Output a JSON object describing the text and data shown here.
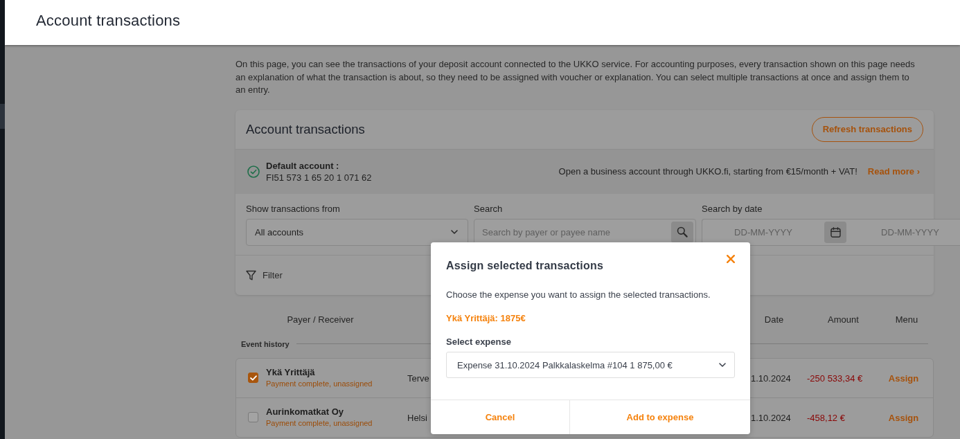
{
  "header": {
    "title": "Account transactions"
  },
  "intro": "On this page, you can see the transactions of your deposit account connected to the UKKO service. For accounting purposes, every transaction shown on this page needs an explanation of what the transaction is about, so they need to be assigned with voucher or explanation. You can select multiple transactions at once and assign them to an entry.",
  "card": {
    "title": "Account transactions",
    "refresh_button": "Refresh transactions",
    "account": {
      "label": "Default account :",
      "number": "FI51 573 1 65 20 1 071 62",
      "promo": "Open a business account through UKKO.fi, starting from €15/month + VAT!",
      "link": "Read more ›"
    },
    "filters": [
      {
        "kind": "select",
        "label": "Show transactions from",
        "value": "All accounts"
      },
      {
        "kind": "search",
        "label": "Search",
        "placeholder": "Search by payer or payee name"
      },
      {
        "kind": "date_range",
        "label": "Search by date",
        "from_placeholder": "DD-MM-YYYY",
        "to_placeholder": "DD-MM-YYYY"
      }
    ],
    "filter_button": "Filter"
  },
  "table": {
    "columns": [
      "Payer / Receiver",
      "Date",
      "Amount",
      "Menu"
    ],
    "section_label": "Event history",
    "rows": [
      {
        "selected": true,
        "name": "Ykä Yrittäjä",
        "status": "Payment complete, unassigned",
        "message": "Terve",
        "date": "1.10.2024",
        "amount": "-250 533,34 €",
        "action": "Assign"
      },
      {
        "selected": false,
        "name": "Aurinkomatkat Oy",
        "status": "Payment complete, unassigned",
        "message": "Helsi",
        "date": "1.10.2024",
        "amount": "-458,12 €",
        "action": "Assign"
      }
    ]
  },
  "modal": {
    "title": "Assign selected transactions",
    "description": "Choose the expense you want to assign the selected transactions.",
    "summary": "Ykä Yrittäjä: 1875€",
    "field_label": "Select expense",
    "field_value": "Expense 31.10.2024 Palkkalaskelma #104 1 875,00 €",
    "buttons": [
      {
        "label": "Cancel",
        "kind": "cancel"
      },
      {
        "label": "Add to expense",
        "kind": "confirm"
      }
    ]
  }
}
